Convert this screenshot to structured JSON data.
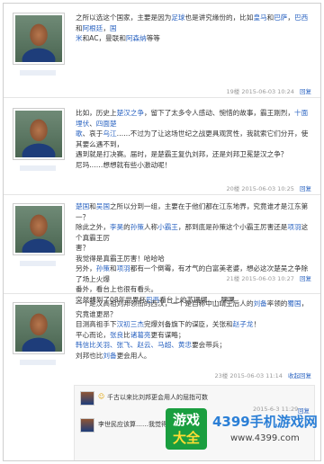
{
  "posts": [
    {
      "lines": [
        [
          {
            "t": "之所以选这个国家，主要是因为"
          },
          {
            "t": "足球",
            "c": "blue"
          },
          {
            "t": "也是讲究缘份的，比如"
          },
          {
            "t": "皇马",
            "c": "blue"
          },
          {
            "t": "和"
          },
          {
            "t": "巴萨",
            "c": "blue"
          },
          {
            "t": "，"
          },
          {
            "t": "巴西",
            "c": "blue"
          },
          {
            "t": "和"
          },
          {
            "t": "阿根廷",
            "c": "blue"
          },
          {
            "t": "，"
          },
          {
            "t": "国",
            "c": "blue"
          }
        ],
        [
          {
            "t": "米",
            "c": "blue"
          },
          {
            "t": "和AC，曼联和"
          },
          {
            "t": "阿森纳",
            "c": "blue"
          },
          {
            "t": "等等"
          }
        ]
      ],
      "meta": {
        "floor": "19楼",
        "time": "2015-06-03 10:24",
        "reply": "回复"
      }
    },
    {
      "lines": [
        [
          {
            "t": "比如，历史上"
          },
          {
            "t": "楚汉之争",
            "c": "blue"
          },
          {
            "t": "，留下了太多令人感动、惋惜的故事，霸王刚烈，"
          },
          {
            "t": "十面埋伏",
            "c": "blue"
          },
          {
            "t": "、"
          },
          {
            "t": "四面楚",
            "c": "blue"
          }
        ],
        [
          {
            "t": "歌",
            "c": "blue"
          },
          {
            "t": "、哀于"
          },
          {
            "t": "乌江",
            "c": "blue"
          },
          {
            "t": "……不过为了让这场世纪之战更具观赏性，我就索它们分开，使其要么遇不到，"
          }
        ],
        [
          {
            "t": "遇到就是打决赛。届时，是楚霸王复仇刘邦，还是刘邦卫冕楚汉之争？"
          }
        ],
        [
          {
            "t": "尼玛……想想就有些小激动呢！"
          }
        ]
      ],
      "meta": {
        "floor": "20楼",
        "time": "2015-06-03 10:25",
        "reply": "回复"
      }
    },
    {
      "lines": [
        [
          {
            "t": "楚国",
            "c": "blue"
          },
          {
            "t": "和"
          },
          {
            "t": "吴国",
            "c": "blue"
          },
          {
            "t": "之所以分到一组，主要在于他们都在江东地界，究竟谁才是江东第一？"
          }
        ],
        [
          {
            "t": "除此之外，"
          },
          {
            "t": "李昊",
            "c": "blue"
          },
          {
            "t": "的"
          },
          {
            "t": "孙策",
            "c": "blue"
          },
          {
            "t": "人称"
          },
          {
            "t": "小霸王",
            "c": "blue"
          },
          {
            "t": "，那到底是孙策这个小霸王厉害还是"
          },
          {
            "t": "项羽",
            "c": "blue"
          },
          {
            "t": "这个真霸王厉"
          }
        ],
        [
          {
            "t": "害？"
          }
        ],
        [
          {
            "t": "我觉得是真霸王厉害！哈哈哈"
          }
        ],
        [
          {
            "t": "另外，"
          },
          {
            "t": "孙策",
            "c": "blue"
          },
          {
            "t": "和"
          },
          {
            "t": "项羽",
            "c": "blue"
          },
          {
            "t": "都有一个倒霉，有才气的白富美老婆，想必这次楚吴之争除了场上火爆"
          }
        ],
        [
          {
            "t": "番外，看台上也很有看头。"
          }
        ],
        [
          {
            "t": "突然想到了08年世界杯"
          },
          {
            "t": "巴西",
            "c": "blue"
          },
          {
            "t": "看台上的苏珊娜……嘿嘿"
          }
        ]
      ],
      "meta": {
        "floor": "21楼",
        "time": "2015-06-03 10:27",
        "reply": "回复"
      }
    },
    {
      "lines": [
        [
          {
            "t": "一个是汉高祖刘邦领衔的西汉，一个是自称中山靖王后人的"
          },
          {
            "t": "刘备",
            "c": "blue"
          },
          {
            "t": "率领的"
          },
          {
            "t": "蜀国",
            "c": "blue"
          },
          {
            "t": "，究竟谁更昂？"
          }
        ],
        [
          {
            "t": "目测高祖手下"
          },
          {
            "t": "汉初三杰",
            "c": "blue"
          },
          {
            "t": "完爆刘备旗下的谋臣，关张和"
          },
          {
            "t": "赵子龙",
            "c": "blue"
          },
          {
            "t": "！"
          }
        ],
        [
          {
            "t": "平心而论，"
          },
          {
            "t": "张良",
            "c": "blue"
          },
          {
            "t": "比"
          },
          {
            "t": "诸葛亮",
            "c": "blue"
          },
          {
            "t": "更有谋略；"
          }
        ],
        [
          {
            "t": "韩信比关羽、张飞、赵云、马超、黄忠",
            "c": "blue"
          },
          {
            "t": "要会带兵；"
          }
        ],
        [
          {
            "t": "刘邦也比"
          },
          {
            "t": "刘备",
            "c": "blue"
          },
          {
            "t": "更会用人。"
          }
        ]
      ],
      "meta": {
        "floor": "23楼",
        "time": "2015-06-03 11:14",
        "reply": "收起回复"
      }
    }
  ],
  "replies": [
    {
      "text": "千古以来比刘邦更会用人的屈指可数",
      "time": "2015-6-3 11:29",
      "reply": "回复"
    },
    {
      "text": "李世民应该算……我觉得……"
    }
  ],
  "watermark": {
    "logo_line1": "游戏",
    "logo_line2": "大全",
    "title": "4399手机游戏网",
    "url": "www.4399.com"
  }
}
